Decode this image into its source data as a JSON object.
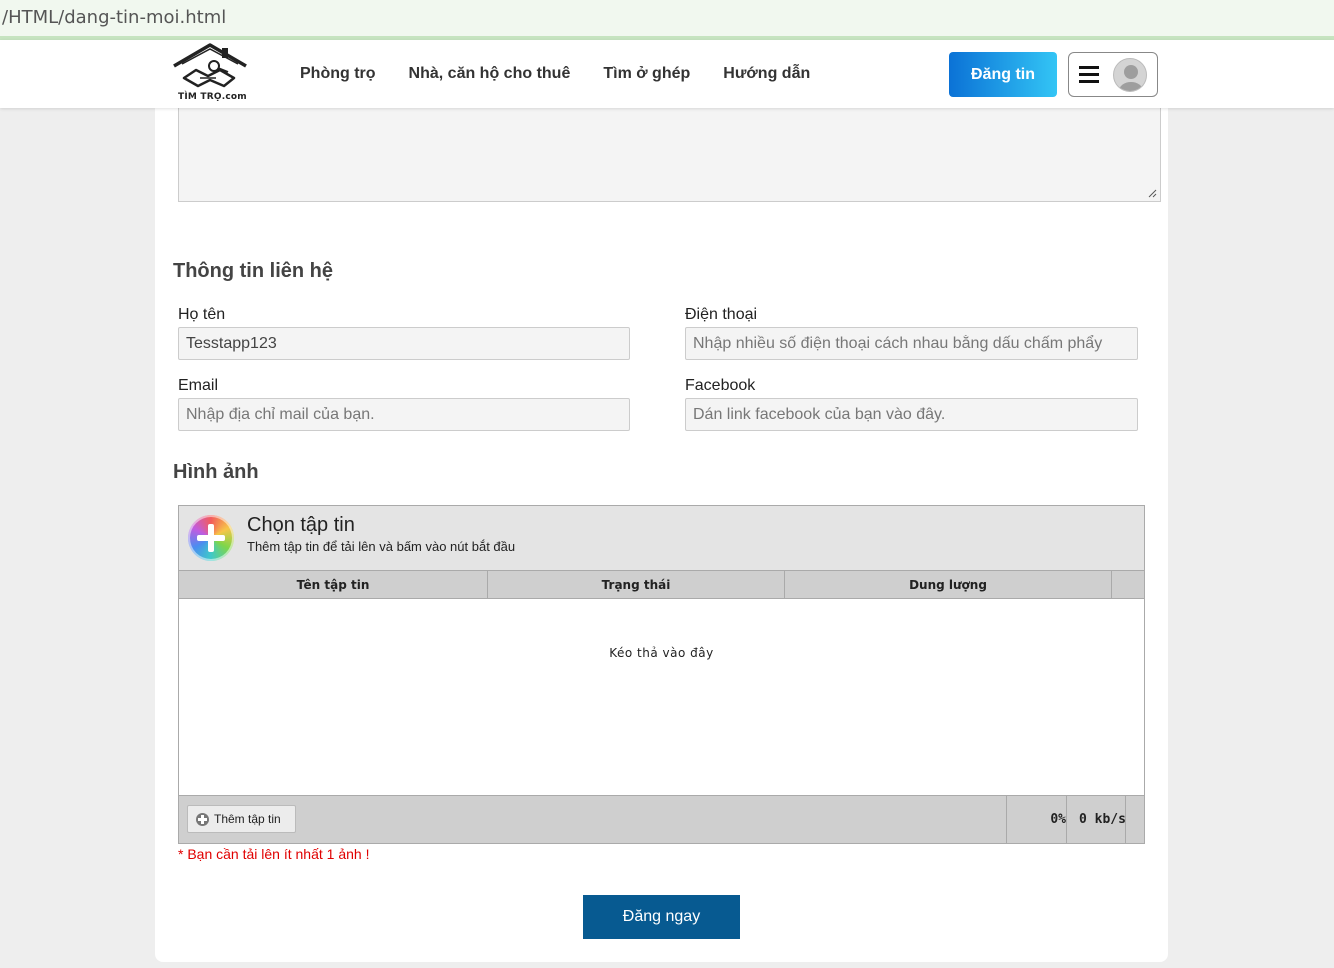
{
  "browser": {
    "url": "/HTML/dang-tin-moi.html"
  },
  "header": {
    "logo_text": "TÌM TRỌ.com",
    "nav": [
      "Phòng trọ",
      "Nhà, căn hộ cho thuê",
      "Tìm ở ghép",
      "Hướng dẫn"
    ],
    "post_button": "Đăng tin",
    "accent_gradient": [
      "#0b72d6",
      "#33c5f5"
    ]
  },
  "contact": {
    "title": "Thông tin liên hệ",
    "name_label": "Họ tên",
    "name_value": "Tesstapp123",
    "phone_label": "Điện thoại",
    "phone_placeholder": "Nhập nhiều số điện thoại cách nhau bằng dấu chấm phẩy",
    "email_label": "Email",
    "email_placeholder": "Nhập địa chỉ mail của bạn.",
    "facebook_label": "Facebook",
    "facebook_placeholder": "Dán link facebook của bạn vào đây."
  },
  "images": {
    "title": "Hình ảnh",
    "uploader_title": "Chọn tập tin",
    "uploader_subtitle": "Thêm tập tin để tải lên và bấm vào nút bắt đầu",
    "columns": [
      "Tên tập tin",
      "Trạng thái",
      "Dung lượng"
    ],
    "drop_text": "Kéo thả vào đây",
    "add_file_button": "Thêm tập tin",
    "progress": "0%",
    "speed": "0 kb/s",
    "error": "* Bạn cần tải lên ít nhất 1 ảnh !"
  },
  "submit_button": "Đăng ngay",
  "submit_color": "#075a91"
}
